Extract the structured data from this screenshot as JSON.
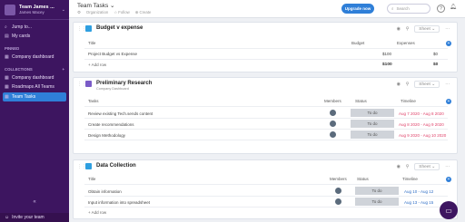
{
  "sidebar": {
    "workspace_name": "Team James ...",
    "workspace_user": "James Macey",
    "nav": [
      {
        "label": "Jump to..."
      },
      {
        "label": "My cards"
      }
    ],
    "pinned_header": "PINNED",
    "pinned": [
      {
        "label": "Company dashboard"
      }
    ],
    "collections_header": "COLLECTIONS",
    "collections": [
      {
        "label": "Company dashboard"
      },
      {
        "label": "Roadmaps All Teams"
      },
      {
        "label": "Team Tasks"
      }
    ],
    "collapse_glyph": "«",
    "invite_label": "Invite your team"
  },
  "header": {
    "title": "Team Tasks",
    "title_chevron": "⌄",
    "sub_org": "Organization",
    "sub_follow": "Follow",
    "sub_create": "Create",
    "upgrade_label": "Upgrade now",
    "search_placeholder": "Search",
    "help_glyph": "?"
  },
  "blocks": {
    "budget": {
      "title": "Budget v expense",
      "sheet_label": "Sheet",
      "col_title": "Title",
      "col_budget": "Budget",
      "col_expenses": "Expenses",
      "rows": [
        {
          "title": "Project Budget vs Expense",
          "budget": "$100",
          "expenses": "$0"
        }
      ],
      "add_row": "Add row",
      "total_budget": "$100",
      "total_expenses": "$0",
      "icon_color": "#2f9fe0"
    },
    "research": {
      "title": "Preliminary Research",
      "subtitle": "Company Dashboard",
      "sheet_label": "Sheet",
      "col_tasks": "Tasks",
      "col_members": "Members",
      "col_status": "Status",
      "col_timeline": "Timeline",
      "rows": [
        {
          "task": "Review existing Tech.sends content",
          "status": "To do",
          "timeline": "Aug 7 2020 - Aug 8 2020"
        },
        {
          "task": "Create recommendations",
          "status": "To do",
          "timeline": "Aug 8 2020 - Aug 9 2020"
        },
        {
          "task": "Design Methodology",
          "status": "To do",
          "timeline": "Aug 9 2020 - Aug 10 2020"
        }
      ],
      "icon_color": "#7a5bc7"
    },
    "collection": {
      "title": "Data Collection",
      "sheet_label": "Sheet",
      "col_title": "Title",
      "col_members": "Members",
      "col_status": "Status",
      "col_timeline": "Timeline",
      "rows": [
        {
          "title": "Obtain information",
          "status": "To do",
          "timeline": "Aug 10 - Aug 12"
        },
        {
          "title": "Input information into spreadsheet",
          "status": "To do",
          "timeline": "Aug 13 - Aug 15"
        }
      ],
      "add_row": "Add row",
      "icon_color": "#2f9fe0"
    }
  },
  "colors": {
    "sidebar_bg": "#3d1560",
    "accent": "#2f7fd8",
    "overdue_date": "#e0436b",
    "future_date": "#2f6ec6"
  }
}
